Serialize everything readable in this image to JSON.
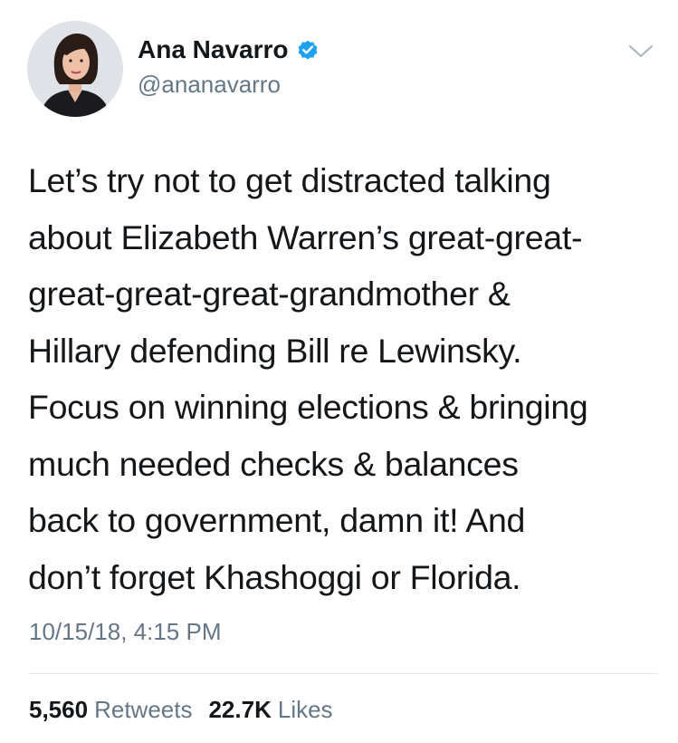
{
  "author": {
    "display_name": "Ana Navarro",
    "handle": "@ananavarro",
    "verified": true,
    "avatar_icon": "profile-photo",
    "verified_icon": "verified-badge-icon"
  },
  "tweet": {
    "lines": [
      "Let’s try not to get distracted talking",
      "about Elizabeth Warren’s great-great-",
      "great-great-great-grandmother &",
      "Hillary defending Bill re Lewinsky.",
      "Focus on winning elections & bringing",
      "much needed checks & balances",
      "back to government, damn it! And",
      "don’t forget Khashoggi or Florida."
    ],
    "timestamp": "10/15/18, 4:15 PM"
  },
  "stats": {
    "retweets_count": "5,560",
    "retweets_label": "Retweets",
    "likes_count": "22.7K",
    "likes_label": "Likes"
  },
  "menu": {
    "icon": "chevron-down-icon"
  },
  "colors": {
    "text": "#14171a",
    "secondary": "#657786",
    "verified_blue": "#1da1f2",
    "divider": "#e1e8ed"
  }
}
